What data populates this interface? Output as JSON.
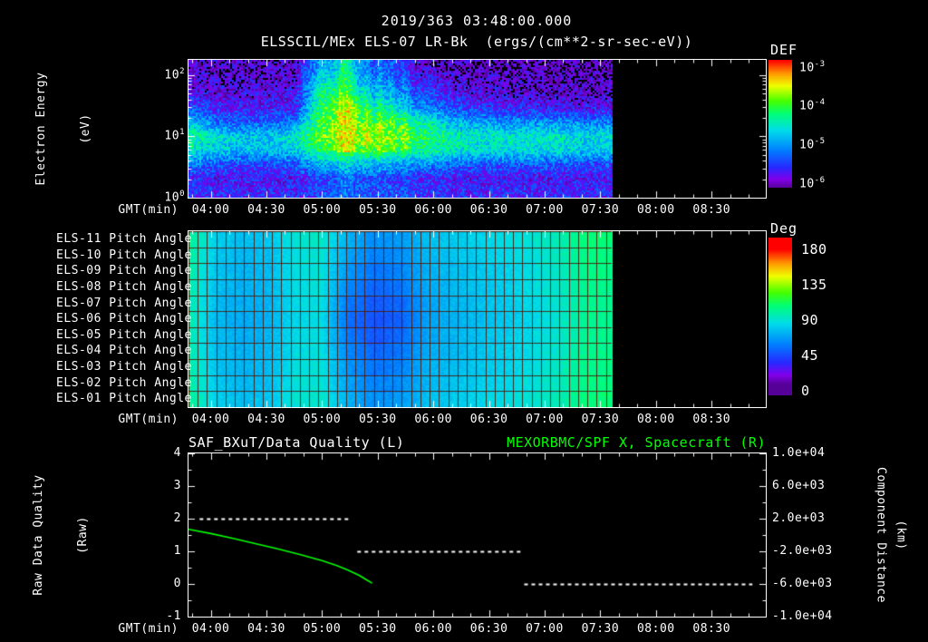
{
  "colors": {
    "background": "#000000",
    "foreground": "#ffffff",
    "series_green": "#00ff00",
    "grid_maroon": "#501400"
  },
  "header": {
    "timestamp": "2019/363 03:48:00.000",
    "title": "ELSSCIL/MEx ELS-07 LR-Bk  (ergs/(cm**2-sr-sec-eV))"
  },
  "axis": {
    "gmt_label": "GMT(min)",
    "log_base": "10",
    "time_ticks": [
      "04:00",
      "04:30",
      "05:00",
      "05:30",
      "06:00",
      "06:30",
      "07:00",
      "07:30",
      "08:00",
      "08:30"
    ],
    "start": "03:48",
    "end": "08:59"
  },
  "panels": {
    "spectrogram": {
      "y_label_line1": "Electron Energy",
      "y_label_line2": "(eV)",
      "y_tick_exponents": [
        2,
        1,
        0
      ],
      "colorbar": {
        "title": "DEF",
        "tick_exponents": [
          -3,
          -4,
          -5,
          -6
        ]
      }
    },
    "pitch": {
      "row_labels": [
        "ELS-11 Pitch Angle",
        "ELS-10 Pitch Angle",
        "ELS-09 Pitch Angle",
        "ELS-08 Pitch Angle",
        "ELS-07 Pitch Angle",
        "ELS-06 Pitch Angle",
        "ELS-05 Pitch Angle",
        "ELS-04 Pitch Angle",
        "ELS-03 Pitch Angle",
        "ELS-02 Pitch Angle",
        "ELS-01 Pitch Angle"
      ],
      "colorbar": {
        "title": "Deg",
        "ticks": [
          180,
          135,
          90,
          45,
          0
        ]
      }
    },
    "timeseries": {
      "left_title": "SAF_BXuT/Data Quality (L)",
      "right_title": "MEXORBMC/SPF X, Spacecraft (R)",
      "left_label_line1": "Raw Data Quality",
      "left_label_line2": "(Raw)",
      "right_label_line1": "Component Distance",
      "right_label_line2": "(km)",
      "left_ticks": [
        4,
        3,
        2,
        1,
        0,
        -1
      ],
      "right_ticks": [
        "1.0e+04",
        "6.0e+03",
        "2.0e+03",
        "-2.0e+03",
        "-6.0e+03",
        "-1.0e+04"
      ]
    }
  },
  "chart_data": [
    {
      "type": "heatmap",
      "name": "ELSSCIL/MEx ELS-07 LR-Bk electron energy spectrogram",
      "units": "ergs/(cm**2-sr-sec-eV)",
      "x_start": "03:48",
      "x_end": "08:59",
      "data_end": "07:36",
      "time_bin_minutes": 14.25,
      "y_scale": "log",
      "log_energy_range": [
        0,
        2.25
      ],
      "row_center_energies_eV": [
        139,
        83,
        49,
        29,
        17,
        10.2,
        6.1,
        3.6,
        2.2,
        1.3
      ],
      "value_log_range": [
        -6.1,
        -2.8
      ],
      "grid_log10_def": [
        [
          -5.9,
          -5.95,
          -5.95,
          -5.95,
          -5.9,
          -4.8,
          -5.0,
          -5.6,
          -5.8,
          -5.9,
          -5.95,
          -6.0,
          -6.0,
          -6.0,
          -6.0,
          -6.0
        ],
        [
          -5.85,
          -5.9,
          -5.9,
          -5.9,
          -5.85,
          -4.5,
          -4.8,
          -5.3,
          -5.6,
          -5.7,
          -5.85,
          -5.9,
          -5.95,
          -5.95,
          -5.95,
          -5.95
        ],
        [
          -5.7,
          -5.8,
          -5.8,
          -5.8,
          -5.75,
          -4.2,
          -4.4,
          -5.0,
          -5.3,
          -5.4,
          -5.7,
          -5.8,
          -5.85,
          -5.85,
          -5.9,
          -5.9
        ],
        [
          -5.3,
          -5.6,
          -5.65,
          -5.65,
          -5.6,
          -4.0,
          -4.1,
          -4.6,
          -4.9,
          -5.0,
          -5.4,
          -5.5,
          -5.6,
          -5.6,
          -5.7,
          -5.7
        ],
        [
          -4.7,
          -5.2,
          -5.3,
          -5.3,
          -5.1,
          -3.9,
          -3.9,
          -4.2,
          -4.3,
          -4.4,
          -4.8,
          -4.9,
          -5.0,
          -5.0,
          -5.0,
          -5.1
        ],
        [
          -4.2,
          -4.6,
          -4.7,
          -4.7,
          -4.5,
          -3.8,
          -3.8,
          -4.0,
          -4.1,
          -4.1,
          -4.4,
          -4.5,
          -4.5,
          -4.5,
          -4.5,
          -4.6
        ],
        [
          -4.5,
          -4.7,
          -4.8,
          -4.8,
          -4.7,
          -4.1,
          -4.1,
          -4.2,
          -4.3,
          -4.3,
          -4.5,
          -4.6,
          -4.6,
          -4.6,
          -4.6,
          -4.7
        ],
        [
          -5.1,
          -5.3,
          -5.4,
          -5.4,
          -5.3,
          -4.8,
          -4.8,
          -4.9,
          -5.0,
          -5.0,
          -5.2,
          -5.3,
          -5.3,
          -5.3,
          -5.3,
          -5.4
        ],
        [
          -5.6,
          -5.7,
          -5.7,
          -5.7,
          -5.7,
          -5.4,
          -5.4,
          -5.5,
          -5.6,
          -5.6,
          -5.7,
          -5.7,
          -5.7,
          -5.7,
          -5.7,
          -5.7
        ],
        [
          -5.5,
          -5.6,
          -5.6,
          -5.6,
          -5.6,
          -5.4,
          -5.4,
          -5.5,
          -5.5,
          -5.5,
          -5.6,
          -5.6,
          -5.6,
          -5.6,
          -5.6,
          -5.6
        ]
      ],
      "bursts": [
        {
          "time": "05:13",
          "sigma_min": 4,
          "amplitude": 0.7
        },
        {
          "time": "05:24",
          "sigma_min": 2,
          "amplitude": 0.45
        },
        {
          "time": "05:31",
          "sigma_min": 2,
          "amplitude": 0.5
        },
        {
          "time": "05:37",
          "sigma_min": 2,
          "amplitude": 0.45
        },
        {
          "time": "05:44",
          "sigma_min": 2,
          "amplitude": 0.4
        }
      ]
    },
    {
      "type": "heatmap",
      "name": "ELS pitch angles",
      "rows": [
        "ELS-11",
        "ELS-10",
        "ELS-09",
        "ELS-08",
        "ELS-07",
        "ELS-06",
        "ELS-05",
        "ELS-04",
        "ELS-03",
        "ELS-02",
        "ELS-01"
      ],
      "x_start": "03:48",
      "data_end": "07:36",
      "time_bin_minutes": 14.25,
      "value_range_deg": [
        0,
        180
      ],
      "grid_degrees": [
        [
          98,
          78,
          72,
          74,
          86,
          88,
          68,
          58,
          62,
          72,
          76,
          79,
          82,
          86,
          92,
          104
        ],
        [
          96,
          76,
          70,
          72,
          84,
          86,
          64,
          54,
          58,
          70,
          74,
          77,
          80,
          84,
          90,
          102
        ],
        [
          95,
          74,
          69,
          71,
          83,
          85,
          60,
          50,
          55,
          68,
          72,
          75,
          78,
          83,
          89,
          101
        ],
        [
          94,
          73,
          68,
          70,
          82,
          84,
          56,
          46,
          51,
          66,
          71,
          74,
          77,
          82,
          88,
          100
        ],
        [
          93,
          72,
          67,
          69,
          81,
          83,
          52,
          42,
          47,
          64,
          70,
          73,
          76,
          81,
          87,
          99
        ],
        [
          93,
          71,
          66,
          68,
          80,
          82,
          50,
          40,
          45,
          63,
          69,
          72,
          75,
          80,
          87,
          99
        ],
        [
          93,
          72,
          67,
          69,
          81,
          83,
          52,
          42,
          47,
          64,
          70,
          73,
          76,
          81,
          87,
          99
        ],
        [
          94,
          73,
          68,
          70,
          82,
          84,
          56,
          46,
          51,
          66,
          71,
          74,
          77,
          82,
          88,
          100
        ],
        [
          95,
          74,
          69,
          71,
          83,
          85,
          60,
          50,
          55,
          68,
          72,
          75,
          78,
          83,
          89,
          101
        ],
        [
          96,
          76,
          70,
          72,
          84,
          86,
          64,
          54,
          58,
          70,
          74,
          77,
          80,
          84,
          90,
          102
        ],
        [
          98,
          78,
          72,
          74,
          86,
          88,
          68,
          58,
          62,
          72,
          76,
          79,
          82,
          86,
          92,
          104
        ]
      ]
    },
    {
      "type": "line",
      "left_axis": {
        "label": "Raw Data Quality (Raw)",
        "min": -1,
        "max": 4
      },
      "right_axis": {
        "label": "Component Distance (km)",
        "min": -10000,
        "max": 10000
      },
      "series": [
        {
          "name": "SAF_BXuT/Data Quality",
          "axis": "left",
          "style": "dashed",
          "color": "#ffffff",
          "segments": [
            {
              "start": "03:54",
              "end": "05:16",
              "value": 2
            },
            {
              "start": "05:19",
              "end": "06:47",
              "value": 1
            },
            {
              "start": "06:49",
              "end": "08:52",
              "value": 0
            }
          ]
        },
        {
          "name": "MEXORBMC/SPF X, Spacecraft",
          "axis": "right",
          "style": "solid",
          "color": "#00ff00",
          "points": [
            [
              "03:48",
              700
            ],
            [
              "04:00",
              180
            ],
            [
              "04:12",
              -420
            ],
            [
              "04:24",
              -1050
            ],
            [
              "04:36",
              -1700
            ],
            [
              "04:48",
              -2400
            ],
            [
              "05:00",
              -3150
            ],
            [
              "05:08",
              -3750
            ],
            [
              "05:14",
              -4300
            ],
            [
              "05:20",
              -4950
            ],
            [
              "05:24",
              -5500
            ],
            [
              "05:27",
              -5900
            ]
          ]
        }
      ]
    }
  ]
}
